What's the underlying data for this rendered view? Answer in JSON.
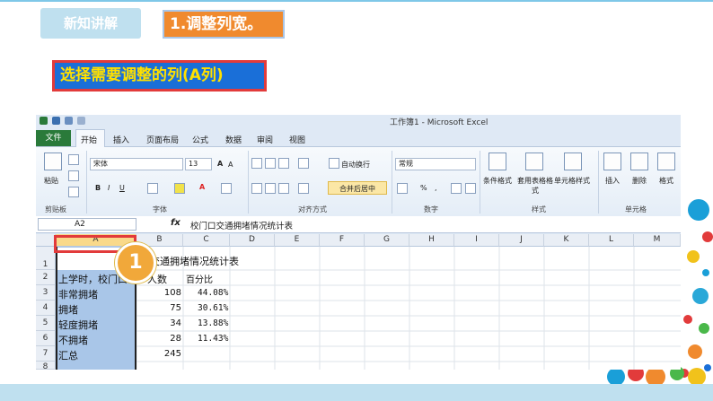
{
  "slide": {
    "badge": "新知讲解",
    "heading": "1.调整列宽。",
    "instruction": "选择需要调整的列(A列)",
    "step_marker": "1"
  },
  "excel": {
    "window_title": "工作簿1 - Microsoft Excel",
    "tabs": [
      "文件",
      "开始",
      "插入",
      "页面布局",
      "公式",
      "数据",
      "审阅",
      "视图"
    ],
    "active_tab": "开始",
    "ribbon": {
      "paste_label": "粘贴",
      "font_name": "宋体",
      "font_size": "13",
      "number_format": "常规",
      "wrap_text": "自动换行",
      "merge_center": "合并后居中",
      "conditional_format": "条件格式",
      "table_format": "套用表格格式",
      "cell_style": "单元格样式",
      "insert": "插入",
      "delete": "删除",
      "format": "格式",
      "groups": [
        "剪贴板",
        "字体",
        "对齐方式",
        "数字",
        "样式",
        "单元格"
      ]
    },
    "name_box": "A2",
    "fx": "fx",
    "formula_text": "校门口交通拥堵情况统计表",
    "columns": [
      "A",
      "B",
      "C",
      "D",
      "E",
      "F",
      "G",
      "H",
      "I",
      "J",
      "K",
      "L",
      "M"
    ],
    "rows": [
      "1",
      "2",
      "3",
      "4",
      "5",
      "6",
      "7",
      "8"
    ],
    "cells": {
      "title": "交通拥堵情况统计表",
      "a2": "上学时，校门口",
      "a2_tail": "人数",
      "c2": "百分比",
      "data": [
        {
          "label": "非常拥堵",
          "count": "108",
          "pct": "44.08%"
        },
        {
          "label": "拥堵",
          "count": "75",
          "pct": "30.61%"
        },
        {
          "label": "轻度拥堵",
          "count": "34",
          "pct": "13.88%"
        },
        {
          "label": "不拥堵",
          "count": "28",
          "pct": "11.43%"
        }
      ],
      "total_label": "汇总",
      "total_count": "245"
    },
    "colors": {
      "selection": "#a9c6e8",
      "file_tab": "#2a7a3a",
      "marker": "#f1a83a"
    }
  }
}
